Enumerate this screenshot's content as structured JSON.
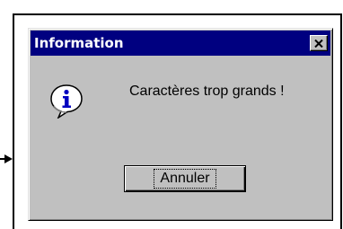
{
  "dialog": {
    "title": "Information",
    "message": "Caractères trop grands !",
    "icon": "info-icon",
    "close_icon": "close-icon",
    "cancel_label": "Annuler"
  },
  "colors": {
    "titlebar": "#000080",
    "title_text": "#ffffff",
    "dialog_face": "#c0c0c0",
    "icon_accent": "#0000c0"
  }
}
